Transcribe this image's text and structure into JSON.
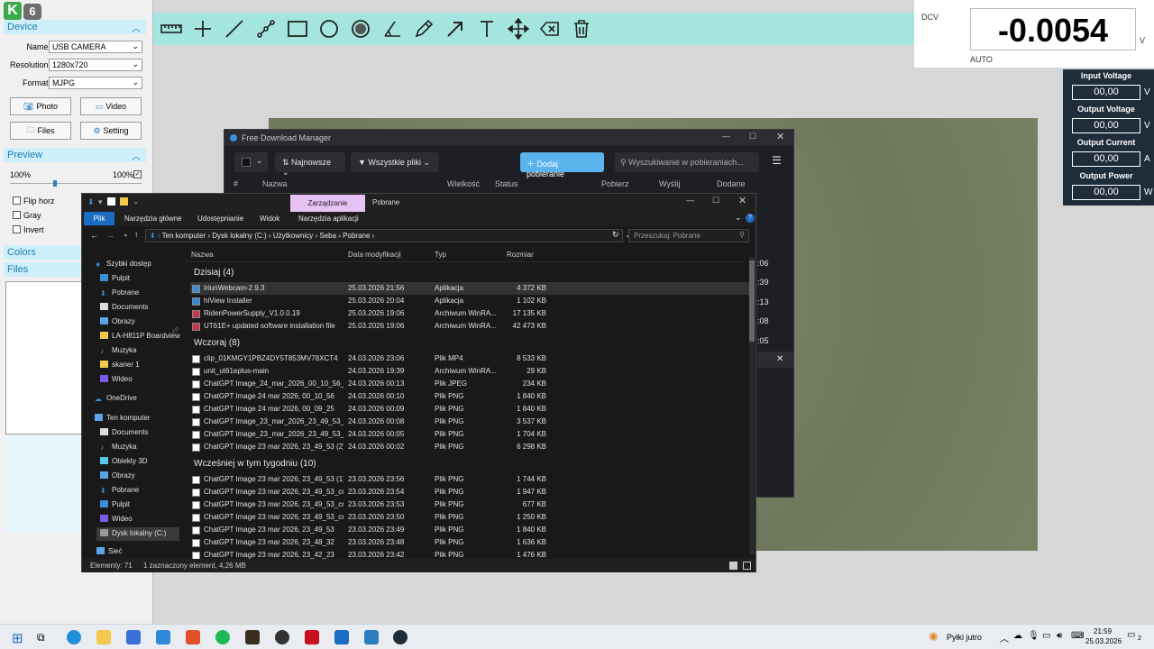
{
  "app": {
    "badge": "6"
  },
  "left_panel": {
    "device": {
      "title": "Device",
      "name_label": "Name:",
      "name_value": "USB CAMERA",
      "resolution_label": "Resolution:",
      "resolution_value": "1280x720",
      "format_label": "Format:",
      "format_value": "MJPG"
    },
    "buttons": {
      "photo": "Photo",
      "video": "Video",
      "files": "Files",
      "setting": "Setting"
    },
    "preview": {
      "title": "Preview",
      "left_pct": "100%",
      "right_pct": "100%"
    },
    "checks": {
      "flip": "Flip horz",
      "gray": "Gray",
      "invert": "Invert"
    },
    "colors_title": "Colors",
    "files_title": "Files"
  },
  "dcv": {
    "label": "DCV",
    "value": "-0.0054",
    "unit": "V",
    "mode": "AUTO"
  },
  "power": {
    "input_voltage": {
      "label": "Input Voltage",
      "value": "00,00",
      "unit": "V"
    },
    "output_voltage": {
      "label": "Output Voltage",
      "value": "00,00",
      "unit": "V"
    },
    "output_current": {
      "label": "Output Current",
      "value": "00,00",
      "unit": "A"
    },
    "output_power": {
      "label": "Output Power",
      "value": "00,00",
      "unit": "W"
    }
  },
  "fdm": {
    "title": "Free Download Manager",
    "sort": "Najnowsze",
    "filter": "Wszystkie pliki",
    "add": "Dodaj pobieranie",
    "search_placeholder": "Wyszukiwanie w pobieraniach...",
    "cols": [
      "#",
      "Nazwa",
      "Wielkość",
      "Status",
      "Pobierz",
      "Wyślij",
      "Dodane"
    ],
    "times": [
      ":06",
      ":39",
      ":13",
      ":08",
      ":05"
    ]
  },
  "explorer": {
    "tab_manage": "Zarządzanie",
    "tab_title": "Pobrane",
    "ribbon": [
      "Plik",
      "Narzędzia główne",
      "Udostępnianie",
      "Widok",
      "Narzędzia aplikacji"
    ],
    "path": [
      "Ten komputer",
      "Dysk lokalny (C:)",
      "Użytkownicy",
      "Seba",
      "Pobrane"
    ],
    "search_placeholder": "Przeszukaj: Pobrane",
    "columns": {
      "name": "Nazwa",
      "date": "Data modyfikacji",
      "type": "Typ",
      "size": "Rozmiar"
    },
    "nav": [
      "Szybki dostęp",
      "Pulpit",
      "Pobrane",
      "Documents",
      "Obrazy",
      "LA-H811P Boardview",
      "Muzyka",
      "skaner 1",
      "Wideo",
      "OneDrive",
      "Ten komputer",
      "Documents",
      "Muzyka",
      "Obiekty 3D",
      "Obrazy",
      "Pobrane",
      "Pulpit",
      "Wideo",
      "Dysk lokalny (C:)",
      "Sieć"
    ],
    "groups": [
      "Dzisiaj (4)",
      "Wczoraj (8)",
      "Wcześniej w tym tygodniu (10)"
    ],
    "files_today": [
      {
        "name": "IriunWebcam-2.9.3",
        "date": "25.03.2026 21:56",
        "type": "Aplikacja",
        "size": "4 372 KB"
      },
      {
        "name": "hiView Installer",
        "date": "25.03.2026 20:04",
        "type": "Aplikacja",
        "size": "1 102 KB"
      },
      {
        "name": "RidenPowerSupply_V1.0.0.19",
        "date": "25.03.2026 19:06",
        "type": "Archiwum WinRA...",
        "size": "17 135 KB"
      },
      {
        "name": "UT61E+ updated software installation file",
        "date": "25.03.2026 19:06",
        "type": "Archiwum WinRA...",
        "size": "42 473 KB"
      }
    ],
    "files_yesterday": [
      {
        "name": "clip_01KMGY1PBZ4DY5T853MV78XCT4",
        "date": "24.03.2026 23:06",
        "type": "Plik MP4",
        "size": "8 533 KB"
      },
      {
        "name": "unit_ut61eplus-main",
        "date": "24.03.2026 19:39",
        "type": "Archiwum WinRA...",
        "size": "29 KB"
      },
      {
        "name": "ChatGPT Image_24_mar_2026_00_10_56_...",
        "date": "24.03.2026 00:13",
        "type": "Plik JPEG",
        "size": "234 KB"
      },
      {
        "name": "ChatGPT Image 24 mar 2026, 00_10_56",
        "date": "24.03.2026 00:10",
        "type": "Plik PNG",
        "size": "1 840 KB"
      },
      {
        "name": "ChatGPT Image 24 mar 2026, 00_09_25",
        "date": "24.03.2026 00:09",
        "type": "Plik PNG",
        "size": "1 840 KB"
      },
      {
        "name": "ChatGPT Image_23_mar_2026_23_49_53_...",
        "date": "24.03.2026 00:08",
        "type": "Plik PNG",
        "size": "3 537 KB"
      },
      {
        "name": "ChatGPT Image_23_mar_2026_23_49_53_...",
        "date": "24.03.2026 00:05",
        "type": "Plik PNG",
        "size": "1 704 KB"
      },
      {
        "name": "ChatGPT Image 23 mar 2026, 23_49_53 (2)",
        "date": "24.03.2026 00:02",
        "type": "Plik PNG",
        "size": "6 298 KB"
      }
    ],
    "files_week": [
      {
        "name": "ChatGPT Image 23 mar 2026, 23_49_53 (1)",
        "date": "23.03.2026 23:56",
        "type": "Plik PNG",
        "size": "1 744 KB"
      },
      {
        "name": "ChatGPT Image 23 mar 2026, 23_49_53_cr...",
        "date": "23.03.2026 23:54",
        "type": "Plik PNG",
        "size": "1 947 KB"
      },
      {
        "name": "ChatGPT Image 23 mar 2026, 23_49_53_cr...",
        "date": "23.03.2026 23:53",
        "type": "Plik PNG",
        "size": "677 KB"
      },
      {
        "name": "ChatGPT Image 23 mar 2026, 23_49_53_cr...",
        "date": "23.03.2026 23:50",
        "type": "Plik PNG",
        "size": "1 250 KB"
      },
      {
        "name": "ChatGPT Image 23 mar 2026, 23_49_53",
        "date": "23.03.2026 23:49",
        "type": "Plik PNG",
        "size": "1 840 KB"
      },
      {
        "name": "ChatGPT Image 23 mar 2026, 23_48_32",
        "date": "23.03.2026 23:48",
        "type": "Plik PNG",
        "size": "1 636 KB"
      },
      {
        "name": "ChatGPT Image 23 mar 2026, 23_42_23",
        "date": "23.03.2026 23:42",
        "type": "Plik PNG",
        "size": "1 476 KB"
      }
    ],
    "status_count": "Elementy: 71",
    "status_selected": "1 zaznaczony element, 4,26 MB"
  },
  "taskbar": {
    "weather": "Pyłki jutro",
    "time": "21:59",
    "date": "25.03.2026",
    "notif": "2"
  }
}
